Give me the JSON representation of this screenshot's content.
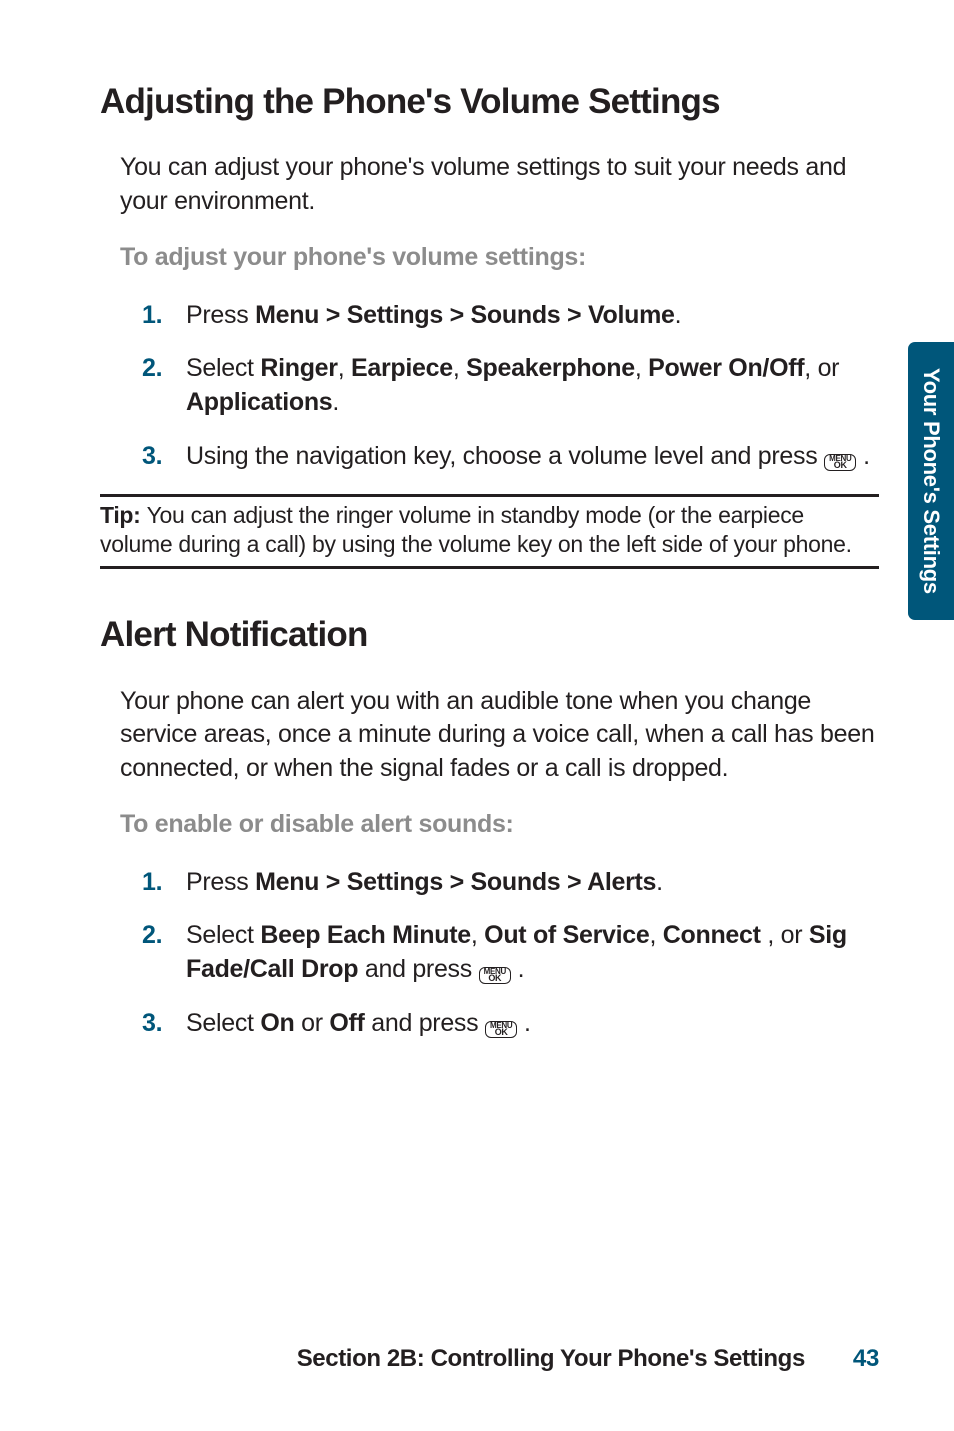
{
  "sideTab": "Your Phone's Settings",
  "icon": {
    "line1": "MENU",
    "line2": "OK"
  },
  "section1": {
    "heading": "Adjusting the Phone's Volume Settings",
    "intro": "You can adjust your phone's volume settings to suit your needs and your environment.",
    "instr": "To adjust your phone's volume settings:",
    "steps": {
      "s1": {
        "num": "1.",
        "pre": "Press ",
        "b1": "Menu > Settings > Sounds > Volume",
        "post": "."
      },
      "s2": {
        "num": "2.",
        "pre": "Select ",
        "b1": "Ringer",
        "c1": ", ",
        "b2": "Earpiece",
        "c2": ", ",
        "b3": "Speakerphone",
        "c3": ", ",
        "b4": "Power On/Off",
        "c4": ", or ",
        "b5": "Applications",
        "post": "."
      },
      "s3": {
        "num": "3.",
        "pre": "Using the navigation key, choose a volume level and press ",
        "post": " ."
      }
    }
  },
  "tip": {
    "label": "Tip: ",
    "text": "You can adjust the ringer volume in standby mode (or the earpiece volume during a call) by using the volume key on the left side of your phone."
  },
  "section2": {
    "heading": "Alert Notification",
    "intro": "Your phone can alert you with an audible tone when you change service areas, once a minute during a voice call, when a call has been connected, or when the signal fades or a call is dropped.",
    "instr": "To enable or disable alert sounds:",
    "steps": {
      "s1": {
        "num": "1.",
        "pre": "Press ",
        "b1": "Menu > Settings > Sounds > Alerts",
        "post": "."
      },
      "s2": {
        "num": "2.",
        "pre": "Select ",
        "b1": "Beep Each Minute",
        "c1": ", ",
        "b2": "Out of Service",
        "c2": ", ",
        "b3": "Connect",
        "c3": " , or ",
        "b4": "Sig Fade/Call Drop",
        "mid": " and press ",
        "post": " ."
      },
      "s3": {
        "num": "3.",
        "pre": "Select ",
        "b1": "On",
        "c1": " or ",
        "b2": "Off",
        "mid": " and press ",
        "post": " ."
      }
    }
  },
  "footer": {
    "section": "Section 2B: Controlling Your Phone's Settings",
    "page": "43"
  }
}
